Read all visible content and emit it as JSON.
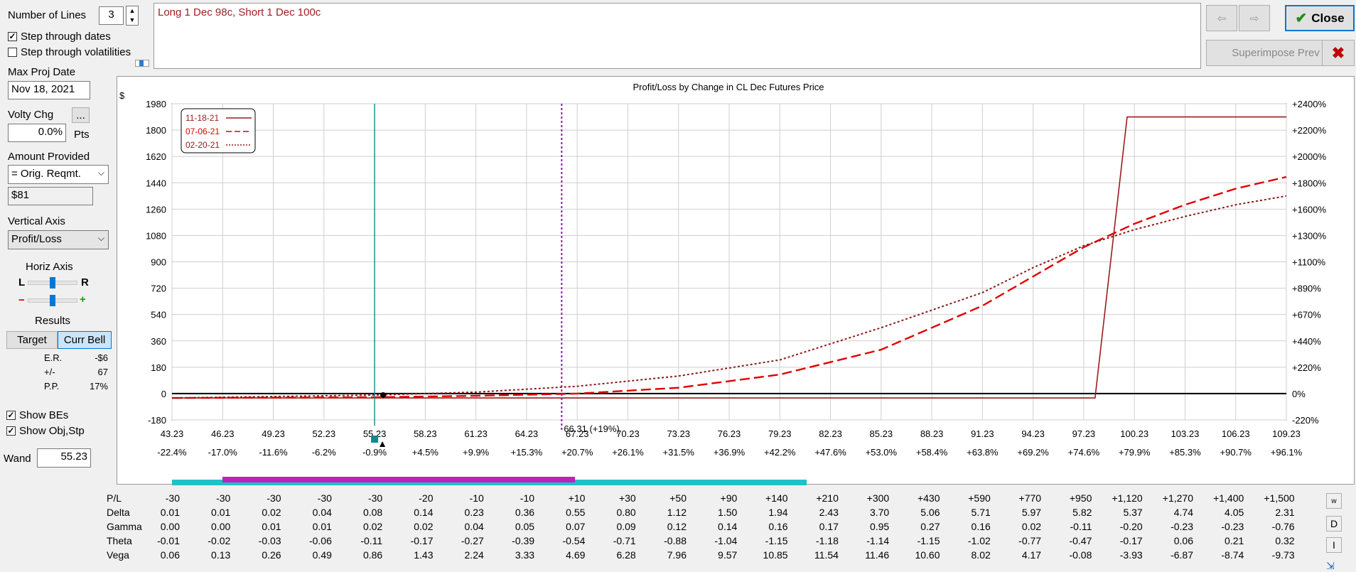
{
  "controls": {
    "number_of_lines_label": "Number of Lines",
    "number_of_lines_value": "3",
    "step_dates_label": "Step through dates",
    "step_vols_label": "Step through volatilities",
    "max_proj_date_label": "Max Proj Date",
    "max_proj_date_value": "Nov 18, 2021",
    "volty_chg_label": "Volty Chg",
    "volty_chg_value": "0.0%",
    "volty_more": "...",
    "pts_label": "Pts",
    "amount_provided_label": "Amount Provided",
    "amount_provided_value": "= Orig. Reqmt.",
    "amount_value": "$81",
    "vertical_axis_label": "Vertical Axis",
    "vertical_axis_value": "Profit/Loss",
    "horiz_axis_label": "Horiz Axis",
    "horiz_l": "L",
    "horiz_r": "R",
    "zoom_minus": "−",
    "zoom_plus": "+",
    "results_label": "Results",
    "target_button": "Target",
    "curr_bell_button": "Curr Bell",
    "results": [
      {
        "k": "E.R.",
        "v": "-$6"
      },
      {
        "k": "+/-",
        "v": "67"
      },
      {
        "k": "P.P.",
        "v": "17%"
      }
    ],
    "show_bes_label": "Show BEs",
    "show_obj_label": "Show Obj,Stp",
    "wand_label": "Wand",
    "wand_value": "55.23"
  },
  "position_text": "Long 1 Dec 98c, Short 1 Dec 100c",
  "buttons": {
    "close": "Close",
    "superimpose": "Superimpose Prev"
  },
  "chart_data": {
    "type": "line",
    "title": "Profit/Loss by Change in CL Dec Futures Price",
    "y_unit": "$",
    "ylim": [
      -180,
      1980
    ],
    "xlim": [
      43.23,
      109.23
    ],
    "y_ticks": [
      -180,
      0,
      180,
      360,
      540,
      720,
      900,
      1080,
      1260,
      1440,
      1620,
      1800,
      1980
    ],
    "y2_ticks": [
      "-220%",
      "0%",
      "+220%",
      "+440%",
      "+670%",
      "+890%",
      "+1100%",
      "+1300%",
      "+1600%",
      "+1800%",
      "+2000%",
      "+2200%",
      "+2400%"
    ],
    "x_ticks": [
      "43.23",
      "46.23",
      "49.23",
      "52.23",
      "55.23",
      "58.23",
      "61.23",
      "64.23",
      "67.23",
      "70.23",
      "73.23",
      "76.23",
      "79.23",
      "82.23",
      "85.23",
      "88.23",
      "91.23",
      "94.23",
      "97.23",
      "100.23",
      "103.23",
      "106.23",
      "109.23"
    ],
    "x_pct_ticks": [
      "-22.4%",
      "-17.0%",
      "-11.6%",
      "-6.2%",
      "-0.9%",
      "+4.5%",
      "+9.9%",
      "+15.3%",
      "+20.7%",
      "+26.1%",
      "+31.5%",
      "+36.9%",
      "+42.2%",
      "+47.6%",
      "+53.0%",
      "+58.4%",
      "+63.8%",
      "+69.2%",
      "+74.6%",
      "+79.9%",
      "+85.3%",
      "+90.7%",
      "+96.1%"
    ],
    "wand_x": 55.23,
    "target_x": 66.31,
    "target_label": "66.31 (+19%)",
    "legend_position": "top-left",
    "grid": true,
    "series": [
      {
        "name": "11-18-21",
        "color": "#9b1c1c",
        "style": "solid",
        "x": [
          43.23,
          97.9,
          99.8,
          109.23
        ],
        "y": [
          -30,
          -30,
          1890,
          1890
        ]
      },
      {
        "name": "07-06-21",
        "color": "#e00000",
        "style": "dashed",
        "x": [
          43.23,
          55.23,
          61.23,
          67.23,
          73.23,
          79.23,
          85.23,
          91.23,
          94.23,
          97.23,
          100.23,
          103.23,
          106.23,
          109.23
        ],
        "y": [
          -30,
          -25,
          -15,
          0,
          40,
          130,
          300,
          600,
          800,
          1000,
          1160,
          1290,
          1400,
          1480
        ]
      },
      {
        "name": "02-20-21",
        "color": "#8b1c1c",
        "style": "dotted",
        "x": [
          43.23,
          55.23,
          61.23,
          67.23,
          73.23,
          79.23,
          85.23,
          91.23,
          94.23,
          97.23,
          100.23,
          103.23,
          106.23,
          109.23
        ],
        "y": [
          -30,
          -10,
          10,
          50,
          120,
          230,
          450,
          690,
          860,
          1010,
          1120,
          1210,
          1290,
          1350
        ]
      }
    ]
  },
  "greeks": {
    "labels": [
      "P/L",
      "Delta",
      "Gamma",
      "Theta",
      "Vega"
    ],
    "rows": [
      [
        "-30",
        "-30",
        "-30",
        "-30",
        "-30",
        "-20",
        "-10",
        "-10",
        "+10",
        "+30",
        "+50",
        "+90",
        "+140",
        "+210",
        "+300",
        "+430",
        "+590",
        "+770",
        "+950",
        "+1,120",
        "+1,270",
        "+1,400",
        "+1,500"
      ],
      [
        "0.01",
        "0.01",
        "0.02",
        "0.04",
        "0.08",
        "0.14",
        "0.23",
        "0.36",
        "0.55",
        "0.80",
        "1.12",
        "1.50",
        "1.94",
        "2.43",
        "3.70",
        "5.06",
        "5.71",
        "5.97",
        "5.82",
        "5.37",
        "4.74",
        "4.05",
        "2.31"
      ],
      [
        "0.00",
        "0.00",
        "0.01",
        "0.01",
        "0.02",
        "0.02",
        "0.04",
        "0.05",
        "0.07",
        "0.09",
        "0.12",
        "0.14",
        "0.16",
        "0.17",
        "0.95",
        "0.27",
        "0.16",
        "0.02",
        "-0.11",
        "-0.20",
        "-0.23",
        "-0.23",
        "-0.76"
      ],
      [
        "-0.01",
        "-0.02",
        "-0.03",
        "-0.06",
        "-0.11",
        "-0.17",
        "-0.27",
        "-0.39",
        "-0.54",
        "-0.71",
        "-0.88",
        "-1.04",
        "-1.15",
        "-1.18",
        "-1.14",
        "-1.15",
        "-1.02",
        "-0.77",
        "-0.47",
        "-0.17",
        "0.06",
        "0.21",
        "0.32"
      ],
      [
        "0.06",
        "0.13",
        "0.26",
        "0.49",
        "0.86",
        "1.43",
        "2.24",
        "3.33",
        "4.69",
        "6.28",
        "7.96",
        "9.57",
        "10.85",
        "11.54",
        "11.46",
        "10.60",
        "8.02",
        "4.17",
        "-0.08",
        "-3.93",
        "-6.87",
        "-8.74",
        "-9.73"
      ]
    ],
    "side_buttons": [
      "w",
      "D",
      "I"
    ]
  }
}
